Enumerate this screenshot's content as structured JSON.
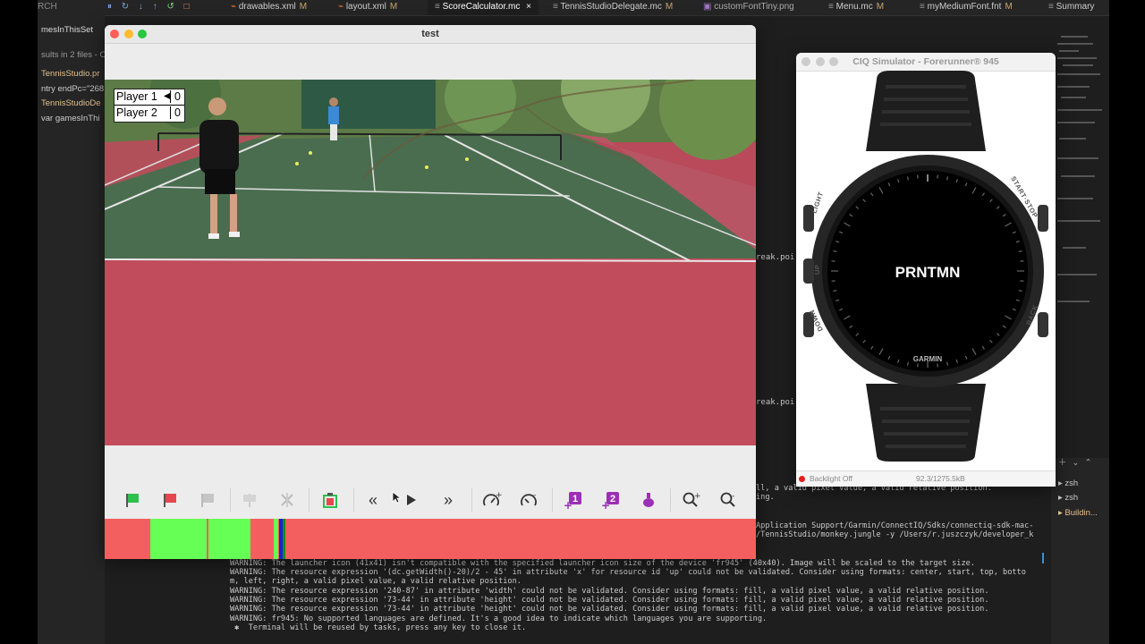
{
  "ide": {
    "tabs": [
      {
        "label": "drawables.xml",
        "modified": "M",
        "icon": "xml-icon"
      },
      {
        "label": "layout.xml",
        "modified": "M",
        "icon": "xml-icon"
      },
      {
        "label": "ScoreCalculator.mc",
        "modified": "",
        "icon": "file-icon",
        "active": true
      },
      {
        "label": "TennisStudioDelegate.mc",
        "modified": "M",
        "icon": "file-icon"
      },
      {
        "label": "customFontTiny.png",
        "modified": "",
        "icon": "image-icon"
      },
      {
        "label": "Menu.mc",
        "modified": "M",
        "icon": "file-icon"
      },
      {
        "label": "myMediumFont.fnt",
        "modified": "M",
        "icon": "file-icon"
      },
      {
        "label": "Summary",
        "modified": "",
        "icon": "file-icon"
      }
    ],
    "sidebar": {
      "search_label": "RCH",
      "search_term": "mesInThisSet",
      "results_text": "sults in 2 files - O",
      "results": [
        "TennisStudio.pr",
        "ntry endPc=\"268",
        "TennisStudioDe",
        "var gamesInThi"
      ]
    },
    "code_fragments": [
      "reak.poi",
      "reak.poi"
    ],
    "terminal": {
      "lines": [
        "ll, a valid pixel value, a valid relative position.",
        "ing.",
        "Application Support/Garmin/ConnectIQ/Sdks/connectiq-sdk-mac-",
        "/TennisStudio/monkey.jungle -y /Users/r.juszczyk/developer_k",
        "WARNING: The launcher icon (41x41) isn't compatible with the specified launcher icon size of the device 'fr945' (40x40). Image will be scaled to the target size.",
        "WARNING: The resource expression '(dc.getWidth()-20)/2 - 45' in attribute 'x' for resource id 'up' could not be validated. Consider using formats: center, start, top, botto",
        "m, left, right, a valid pixel value, a valid relative position.",
        "WARNING: The resource expression '240-87' in attribute 'width' could not be validated. Consider using formats: fill, a valid pixel value, a valid relative position.",
        "WARNING: The resource expression '73-44' in attribute 'height' could not be validated. Consider using formats: fill, a valid pixel value, a valid relative position.",
        "WARNING: The resource expression '73-44' in attribute 'height' could not be validated. Consider using formats: fill, a valid pixel value, a valid relative position.",
        "WARNING: fr945: No supported languages are defined. It's a good idea to indicate which languages you are supporting.",
        " ✱  Terminal will be reused by tasks, press any key to close it."
      ],
      "sessions": [
        "zsh",
        "zsh",
        "Buildin..."
      ]
    }
  },
  "test_window": {
    "title": "test",
    "scoreboard": [
      {
        "player": "Player 1",
        "score": "0",
        "serving": true
      },
      {
        "player": "Player 2",
        "score": "0",
        "serving": false
      }
    ],
    "toolbar": [
      {
        "name": "flag-green-icon",
        "group": 1
      },
      {
        "name": "flag-red-icon",
        "group": 1
      },
      {
        "name": "flag-gray-icon",
        "group": 1,
        "disabled": true
      },
      {
        "name": "flag-remove-icon",
        "group": 2,
        "disabled": true
      },
      {
        "name": "flag-clear-icon",
        "group": 2,
        "disabled": true
      },
      {
        "name": "trash-icon",
        "group": 3
      },
      {
        "name": "rewind-icon",
        "group": 4
      },
      {
        "name": "play-icon",
        "group": 4
      },
      {
        "name": "fast-forward-icon",
        "group": 4
      },
      {
        "name": "speed-up-icon",
        "group": 5
      },
      {
        "name": "speed-down-icon",
        "group": 5
      },
      {
        "name": "player1-point-icon",
        "label": "1",
        "group": 6
      },
      {
        "name": "player2-point-icon",
        "label": "2",
        "group": 6
      },
      {
        "name": "flask-icon",
        "group": 6
      },
      {
        "name": "zoom-in-icon",
        "group": 7
      },
      {
        "name": "zoom-out-icon",
        "group": 7
      }
    ],
    "timeline": {
      "base_color": "#f35f5f",
      "segments": [
        {
          "start": 0.0,
          "end": 0.07,
          "color": "#f35f5f"
        },
        {
          "start": 0.07,
          "end": 0.157,
          "color": "#66ff55"
        },
        {
          "start": 0.16,
          "end": 0.225,
          "color": "#66ff55"
        },
        {
          "start": 0.26,
          "end": 0.267,
          "color": "#66ff55"
        },
        {
          "start": 0.268,
          "end": 0.273,
          "color": "#1f1fd0"
        },
        {
          "start": 0.273,
          "end": 0.277,
          "color": "#1a8a1a"
        }
      ]
    }
  },
  "simulator": {
    "title": "CIQ Simulator - Forerunner® 945",
    "screen_text": "PRNTMN",
    "brand": "GARMIN",
    "button_labels": [
      "LIGHT",
      "UP",
      "DOWN",
      "START·STOP",
      "BACK"
    ],
    "status_label": "Backlight Off",
    "memory": "92.3/1275.5kB",
    "status_color": "#e02020"
  }
}
